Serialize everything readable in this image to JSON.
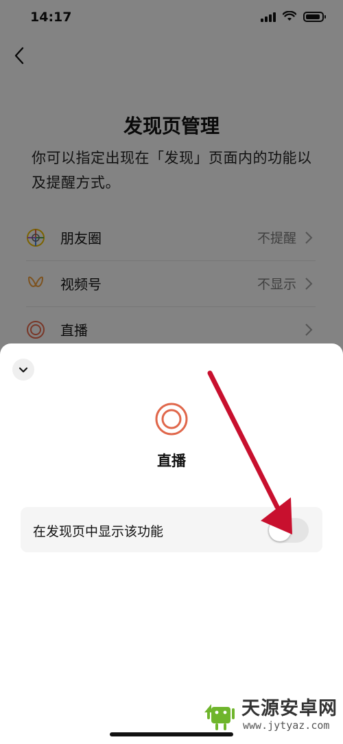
{
  "status_bar": {
    "time": "14:17"
  },
  "page": {
    "title": "发现页管理",
    "description": "你可以指定出现在「发现」页面内的功能以及提醒方式。",
    "rows": [
      {
        "label": "朋友圈",
        "value": "不提醒",
        "icon": "moments-icon"
      },
      {
        "label": "视频号",
        "value": "不显示",
        "icon": "channels-icon"
      },
      {
        "label": "直播",
        "value": "",
        "icon": "live-icon"
      }
    ]
  },
  "sheet": {
    "title": "直播",
    "toggle_label": "在发现页中显示该功能",
    "toggle_on": false,
    "icon": "live-icon",
    "accent": "#e0674b"
  },
  "watermark": {
    "name": "天源安卓网",
    "url": "www.jytyaz.com"
  }
}
